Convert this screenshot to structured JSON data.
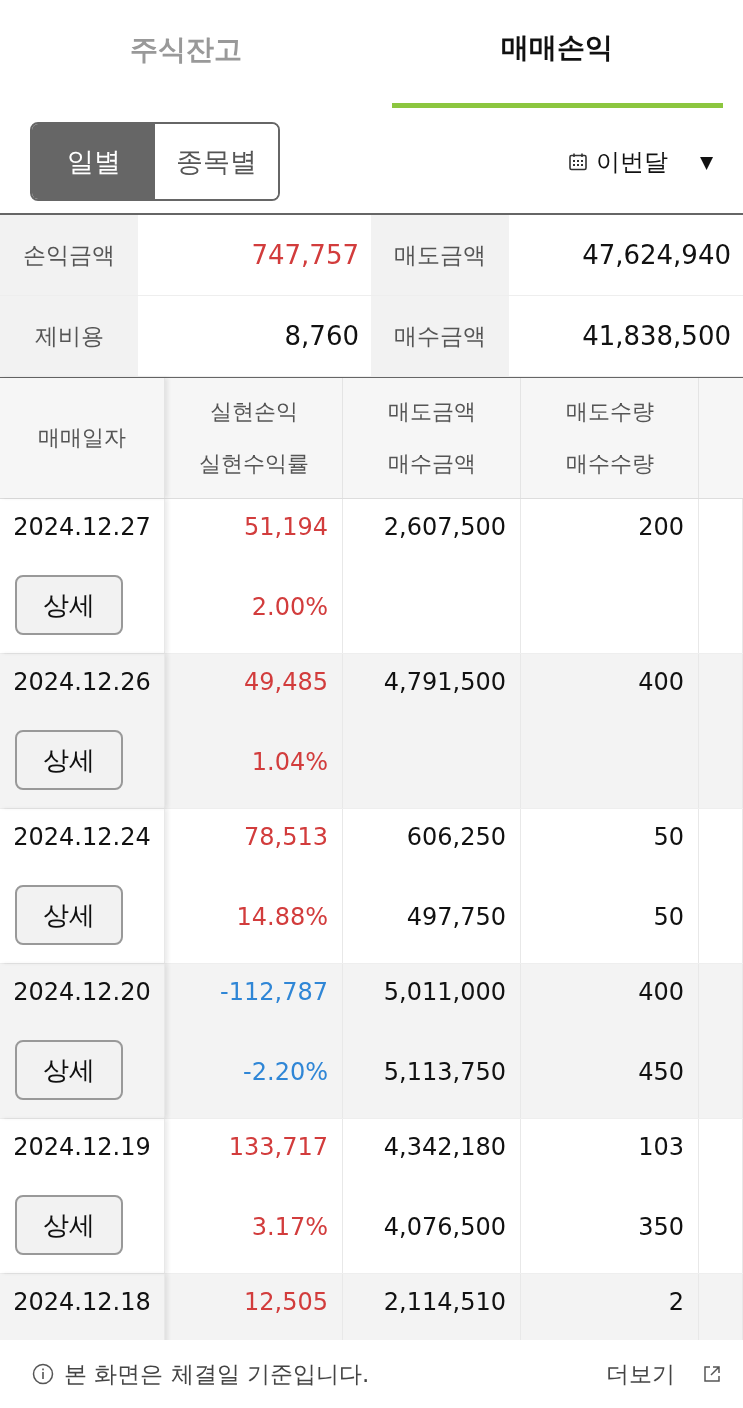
{
  "tabs": [
    {
      "label": "주식잔고",
      "selected": false
    },
    {
      "label": "매매손익",
      "selected": true
    }
  ],
  "view_toggle": [
    {
      "label": "일별",
      "selected": true
    },
    {
      "label": "종목별",
      "selected": false
    }
  ],
  "period": {
    "label": "이번달",
    "caret": "▼"
  },
  "summary": [
    {
      "label": "손익금액",
      "value": "747,757",
      "color": "#d23c3c"
    },
    {
      "label": "매도금액",
      "value": "47,624,940",
      "color": "#111111"
    },
    {
      "label": "제비용",
      "value": "8,760",
      "color": "#111111"
    },
    {
      "label": "매수금액",
      "value": "41,838,500",
      "color": "#111111"
    }
  ],
  "table": {
    "columns": [
      {
        "lines": [
          "매매일자"
        ]
      },
      {
        "lines": [
          "실현손익",
          "실현수익률"
        ]
      },
      {
        "lines": [
          "매도금액",
          "매수금액"
        ]
      },
      {
        "lines": [
          "매도수량",
          "매수수량"
        ]
      }
    ],
    "rows": [
      {
        "date": "2024.12.27",
        "pnl": "51,194",
        "rate": "2.00%",
        "color": "#d23c3c",
        "sell_amount": "2,607,500",
        "sell_qty": "200",
        "detail_button": "상세"
      },
      {
        "date": "2024.12.26",
        "pnl": "49,485",
        "rate": "1.04%",
        "color": "#d23c3c",
        "sell_amount": "4,791,500",
        "sell_qty": "400",
        "detail_button": "상세"
      },
      {
        "date": "2024.12.24",
        "pnl": "78,513",
        "rate": "14.88%",
        "color": "#d23c3c",
        "sell_amount": "606,250",
        "buy_amount": "497,750",
        "sell_qty": "50",
        "buy_qty": "50",
        "detail_button": "상세"
      },
      {
        "date": "2024.12.20",
        "pnl": "-112,787",
        "rate": "-2.20%",
        "color": "#2f86d6",
        "sell_amount": "5,011,000",
        "buy_amount": "5,113,750",
        "sell_qty": "400",
        "buy_qty": "450",
        "detail_button": "상세"
      },
      {
        "date": "2024.12.19",
        "pnl": "133,717",
        "rate": "3.17%",
        "color": "#d23c3c",
        "sell_amount": "4,342,180",
        "buy_amount": "4,076,500",
        "sell_qty": "103",
        "buy_qty": "350",
        "detail_button": "상세"
      },
      {
        "date": "2024.12.18",
        "pnl": "12,505",
        "color": "#d23c3c",
        "sell_amount": "2,114,510",
        "sell_qty": "2"
      }
    ]
  },
  "footer": {
    "notice": "본 화면은 체결일 기준입니다.",
    "more_link": "더보기"
  }
}
